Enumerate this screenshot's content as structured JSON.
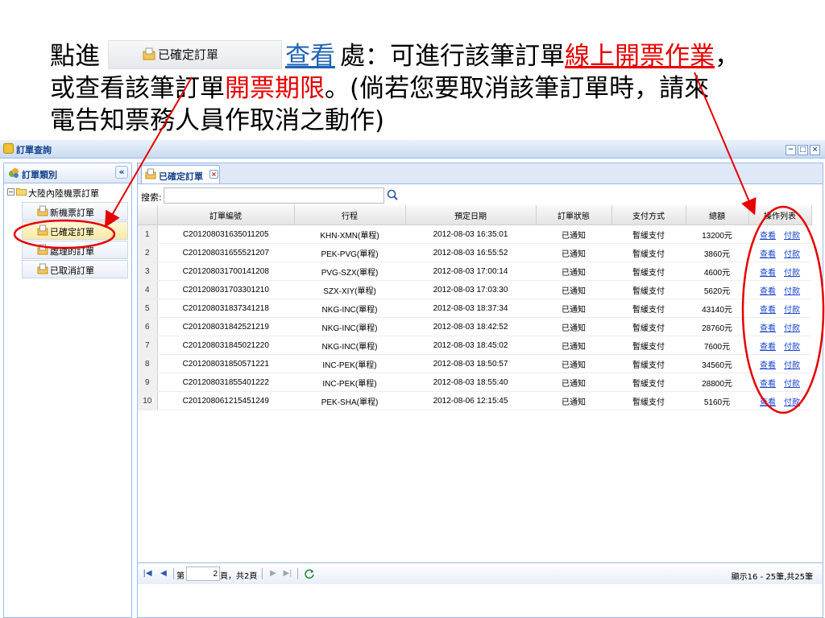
{
  "annotation": {
    "line1_prefix": "點進",
    "chip_label": "已確定訂單",
    "chaxun_label": "查看",
    "line1_mid": "處：可進行該筆訂單",
    "line1_red": "線上開票作業",
    "line1_tail": "，",
    "line2_prefix": "或查看該筆訂單",
    "line2_red": "開票期限",
    "line2_tail": "。(倘若您要取消該筆訂單時，請來",
    "line3": "電告知票務人員作取消之動作)"
  },
  "window": {
    "title": "訂單查詢",
    "buttons": [
      "−",
      "□",
      "×"
    ]
  },
  "sidebar": {
    "title": "訂單類別",
    "collapse_symbol": "«",
    "root_label": "大陸內陸機票訂單",
    "items": [
      {
        "label": "新機票訂單"
      },
      {
        "label": "已確定訂單"
      },
      {
        "label": "處理的訂單"
      },
      {
        "label": "已取消訂單"
      }
    ]
  },
  "tab": {
    "label": "已確定訂單",
    "close_symbol": "×"
  },
  "search": {
    "label": "搜索:",
    "value": ""
  },
  "grid": {
    "headers": [
      "",
      "訂單編號",
      "行程",
      "預定日期",
      "訂單狀態",
      "支付方式",
      "總額",
      "操作列表"
    ],
    "action_view": "查看",
    "action_pay": "付款",
    "rows": [
      {
        "no": "1",
        "order": "C201208031635011205",
        "route": "KHN-XMN(單程)",
        "date": "2012-08-03 16:35:01",
        "status": "已通知",
        "pay": "暫緩支付",
        "total": "13200元"
      },
      {
        "no": "2",
        "order": "C201208031655521207",
        "route": "PEK-PVG(單程)",
        "date": "2012-08-03 16:55:52",
        "status": "已通知",
        "pay": "暫緩支付",
        "total": "3860元"
      },
      {
        "no": "3",
        "order": "C201208031700141208",
        "route": "PVG-SZX(單程)",
        "date": "2012-08-03 17:00:14",
        "status": "已通知",
        "pay": "暫緩支付",
        "total": "4600元"
      },
      {
        "no": "4",
        "order": "C201208031703301210",
        "route": "SZX-XIY(單程)",
        "date": "2012-08-03 17:03:30",
        "status": "已通知",
        "pay": "暫緩支付",
        "total": "5620元"
      },
      {
        "no": "5",
        "order": "C201208031837341218",
        "route": "NKG-INC(單程)",
        "date": "2012-08-03 18:37:34",
        "status": "已通知",
        "pay": "暫緩支付",
        "total": "43140元"
      },
      {
        "no": "6",
        "order": "C201208031842521219",
        "route": "NKG-INC(單程)",
        "date": "2012-08-03 18:42:52",
        "status": "已通知",
        "pay": "暫緩支付",
        "total": "28760元"
      },
      {
        "no": "7",
        "order": "C201208031845021220",
        "route": "NKG-INC(單程)",
        "date": "2012-08-03 18:45:02",
        "status": "已通知",
        "pay": "暫緩支付",
        "total": "7600元"
      },
      {
        "no": "8",
        "order": "C201208031850571221",
        "route": "INC-PEK(單程)",
        "date": "2012-08-03 18:50:57",
        "status": "已通知",
        "pay": "暫緩支付",
        "total": "34560元"
      },
      {
        "no": "9",
        "order": "C201208031855401222",
        "route": "INC-PEK(單程)",
        "date": "2012-08-03 18:55:40",
        "status": "已通知",
        "pay": "暫緩支付",
        "total": "28800元"
      },
      {
        "no": "10",
        "order": "C201208061215451249",
        "route": "PEK-SHA(單程)",
        "date": "2012-08-06 12:15:45",
        "status": "已通知",
        "pay": "暫緩支付",
        "total": "5160元"
      }
    ]
  },
  "pager": {
    "page_prefix": "第",
    "page_value": "2",
    "page_suffix": "頁，共2頁",
    "display": "顯示16 - 25筆,共25筆"
  },
  "colors": {
    "annotation_red": "#e60000",
    "link_blue": "#1a44cc",
    "panel_border": "#99bbe8"
  }
}
